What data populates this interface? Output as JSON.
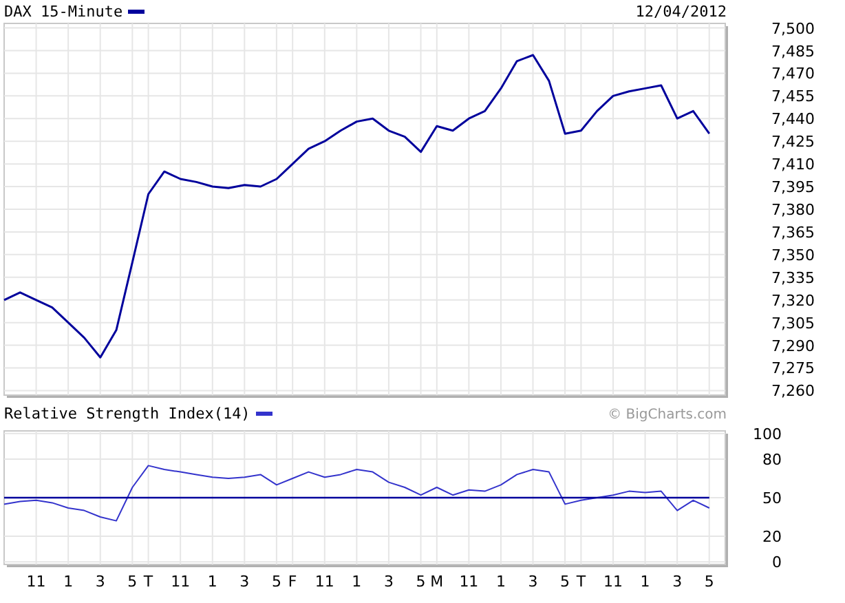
{
  "price_chart": {
    "date": "12/04/2012",
    "chart_data": {
      "type": "line",
      "title": "DAX 15-Minute",
      "series": [
        {
          "color": "#00009c",
          "values": [
            7320,
            7325,
            7320,
            7315,
            7305,
            7295,
            7282,
            7300,
            7345,
            7390,
            7405,
            7400,
            7398,
            7395,
            7394,
            7396,
            7395,
            7400,
            7410,
            7420,
            7425,
            7432,
            7438,
            7440,
            7432,
            7428,
            7418,
            7435,
            7432,
            7440,
            7445,
            7460,
            7478,
            7482,
            7465,
            7430,
            7432,
            7445,
            7455,
            7458,
            7460,
            7462,
            7440,
            7445,
            7430
          ]
        }
      ],
      "ylim": [
        7257,
        7503
      ],
      "grid": true,
      "yticks": [
        {
          "value": 7500,
          "label": "7,500"
        },
        {
          "value": 7485,
          "label": "7,485"
        },
        {
          "value": 7470,
          "label": "7,470"
        },
        {
          "value": 7455,
          "label": "7,455"
        },
        {
          "value": 7440,
          "label": "7,440"
        },
        {
          "value": 7425,
          "label": "7,425"
        },
        {
          "value": 7410,
          "label": "7,410"
        },
        {
          "value": 7395,
          "label": "7,395"
        },
        {
          "value": 7380,
          "label": "7,380"
        },
        {
          "value": 7365,
          "label": "7,365"
        },
        {
          "value": 7350,
          "label": "7,350"
        },
        {
          "value": 7335,
          "label": "7,335"
        },
        {
          "value": 7320,
          "label": "7,320"
        },
        {
          "value": 7305,
          "label": "7,305"
        },
        {
          "value": 7290,
          "label": "7,290"
        },
        {
          "value": 7275,
          "label": "7,275"
        },
        {
          "value": 7260,
          "label": "7,260"
        }
      ]
    }
  },
  "rsi_chart": {
    "credit": "© BigCharts.com",
    "chart_data": {
      "type": "line",
      "title": "Relative Strength Index(14)",
      "categories": [
        null,
        null,
        "11",
        null,
        "1",
        null,
        "3",
        null,
        "5",
        "T",
        null,
        "11",
        null,
        "1",
        null,
        "3",
        null,
        "5",
        "F",
        null,
        "11",
        null,
        "1",
        null,
        "3",
        null,
        "5",
        "M",
        null,
        "11",
        null,
        "1",
        null,
        "3",
        null,
        "5",
        "T",
        null,
        "11",
        null,
        "1",
        null,
        "3",
        null,
        "5"
      ],
      "series": [
        {
          "color": "#3333cc",
          "values": [
            45,
            47,
            48,
            46,
            42,
            40,
            35,
            32,
            58,
            75,
            72,
            70,
            68,
            66,
            65,
            66,
            68,
            60,
            65,
            70,
            66,
            68,
            72,
            70,
            62,
            58,
            52,
            58,
            52,
            56,
            55,
            60,
            68,
            72,
            70,
            45,
            48,
            50,
            52,
            55,
            54,
            55,
            40,
            48,
            42
          ]
        },
        {
          "color": "#00009c",
          "values": [
            50,
            50,
            50,
            50,
            50,
            50,
            50,
            50,
            50,
            50,
            50,
            50,
            50,
            50,
            50,
            50,
            50,
            50,
            50,
            50,
            50,
            50,
            50,
            50,
            50,
            50,
            50,
            50,
            50,
            50,
            50,
            50,
            50,
            50,
            50,
            50,
            50,
            50,
            50,
            50,
            50,
            50,
            50,
            50,
            50
          ]
        }
      ],
      "ylim": [
        -2,
        102
      ],
      "grid": true,
      "yticks": [
        100,
        80,
        50,
        20,
        0
      ]
    }
  }
}
